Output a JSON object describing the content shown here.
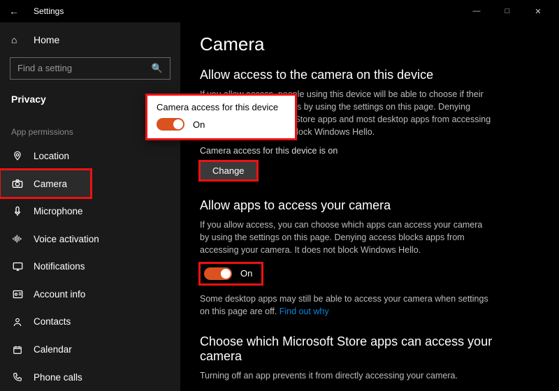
{
  "window": {
    "title": "Settings"
  },
  "sidebar": {
    "home": "Home",
    "search_placeholder": "Find a setting",
    "category": "Privacy",
    "group_title": "App permissions",
    "items": [
      {
        "label": "Location"
      },
      {
        "label": "Camera"
      },
      {
        "label": "Microphone"
      },
      {
        "label": "Voice activation"
      },
      {
        "label": "Notifications"
      },
      {
        "label": "Account info"
      },
      {
        "label": "Contacts"
      },
      {
        "label": "Calendar"
      },
      {
        "label": "Phone calls"
      }
    ]
  },
  "page": {
    "title": "Camera",
    "section1": {
      "heading": "Allow access to the camera on this device",
      "desc": "If you allow access, people using this device will be able to choose if their apps have camera access by using the settings on this page. Denying access blocks Microsoft Store apps and most desktop apps from accessing the camera. It does not block Windows Hello.",
      "status": "Camera access for this device is on",
      "change_btn": "Change"
    },
    "section2": {
      "heading": "Allow apps to access your camera",
      "desc": "If you allow access, you can choose which apps can access your camera by using the settings on this page. Denying access blocks apps from accessing your camera. It does not block Windows Hello.",
      "toggle_label": "On",
      "note": "Some desktop apps may still be able to access your camera when settings on this page are off. ",
      "note_link": "Find out why"
    },
    "section3": {
      "heading": "Choose which Microsoft Store apps can access your camera",
      "desc": "Turning off an app prevents it from directly accessing your camera."
    }
  },
  "popup": {
    "title": "Camera access for this device",
    "toggle_label": "On"
  }
}
